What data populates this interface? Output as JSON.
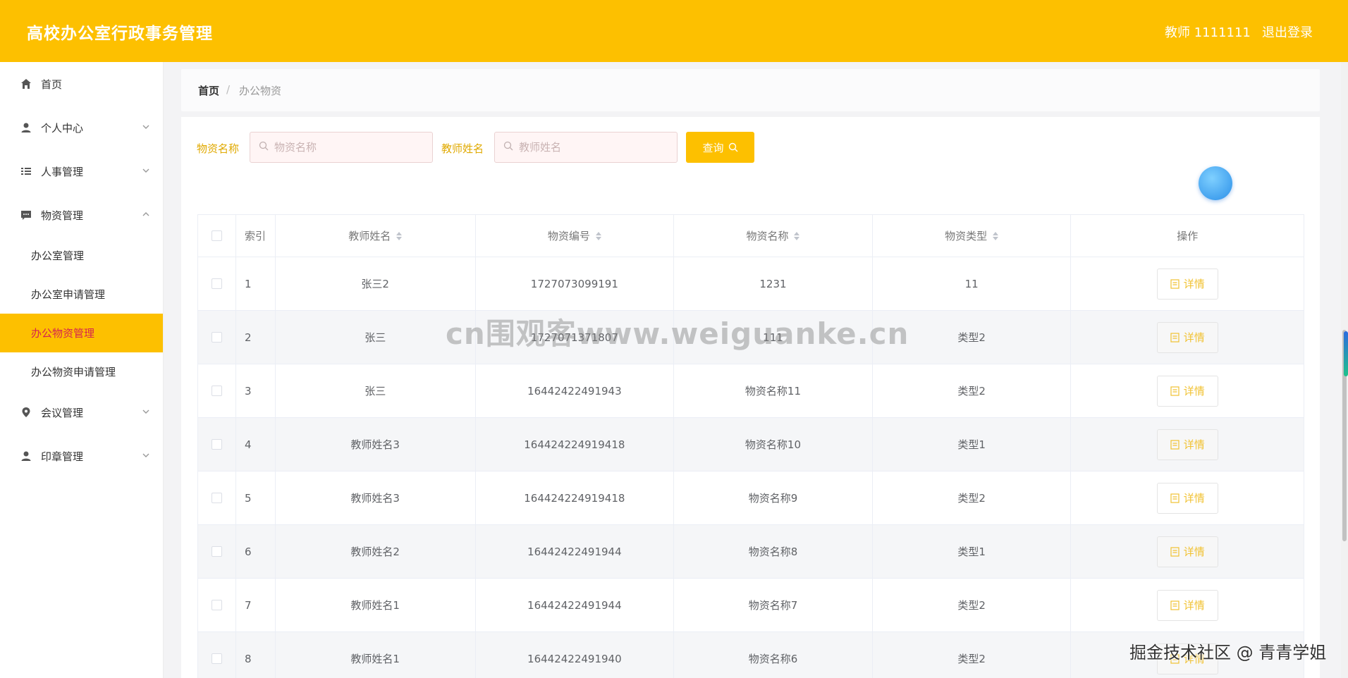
{
  "header": {
    "title": "高校办公室行政事务管理",
    "user": "教师 1111111",
    "logout": "退出登录"
  },
  "sidebar": {
    "items": [
      {
        "label": "首页",
        "icon": "home-icon"
      },
      {
        "label": "个人中心",
        "icon": "user-icon"
      },
      {
        "label": "人事管理",
        "icon": "list-icon"
      },
      {
        "label": "物资管理",
        "icon": "message-icon"
      },
      {
        "label": "会议管理",
        "icon": "location-icon"
      },
      {
        "label": "印章管理",
        "icon": "user-icon"
      }
    ],
    "sub_items": [
      {
        "label": "办公室管理"
      },
      {
        "label": "办公室申请管理"
      },
      {
        "label": "办公物资管理"
      },
      {
        "label": "办公物资申请管理"
      }
    ]
  },
  "breadcrumb": {
    "home": "首页",
    "sep": "/",
    "current": "办公物资"
  },
  "filters": {
    "name_label": "物资名称",
    "name_placeholder": "物资名称",
    "teacher_label": "教师姓名",
    "teacher_placeholder": "教师姓名",
    "query_label": "查询"
  },
  "table": {
    "headers": {
      "index": "索引",
      "teacher": "教师姓名",
      "code": "物资编号",
      "name": "物资名称",
      "type": "物资类型",
      "op": "操作"
    },
    "detail_label": "详情",
    "rows": [
      {
        "index": "1",
        "teacher": "张三2",
        "code": "1727073099191",
        "name": "1231",
        "type": "11"
      },
      {
        "index": "2",
        "teacher": "张三",
        "code": "1727071371807",
        "name": "111",
        "type": "类型2"
      },
      {
        "index": "3",
        "teacher": "张三",
        "code": "16442422491943",
        "name": "物资名称11",
        "type": "类型2"
      },
      {
        "index": "4",
        "teacher": "教师姓名3",
        "code": "164424224919418",
        "name": "物资名称10",
        "type": "类型1"
      },
      {
        "index": "5",
        "teacher": "教师姓名3",
        "code": "164424224919418",
        "name": "物资名称9",
        "type": "类型2"
      },
      {
        "index": "6",
        "teacher": "教师姓名2",
        "code": "16442422491944",
        "name": "物资名称8",
        "type": "类型1"
      },
      {
        "index": "7",
        "teacher": "教师姓名1",
        "code": "16442422491944",
        "name": "物资名称7",
        "type": "类型2"
      },
      {
        "index": "8",
        "teacher": "教师姓名1",
        "code": "16442422491940",
        "name": "物资名称6",
        "type": "类型2"
      }
    ]
  },
  "overlay": {
    "watermark": "cn围观客www.weiguanke.cn",
    "credit": "掘金技术社区 @ 青青学姐"
  },
  "colors": {
    "accent": "#fdc000",
    "active_text": "#d6244f",
    "detail_text": "#f1c232"
  }
}
